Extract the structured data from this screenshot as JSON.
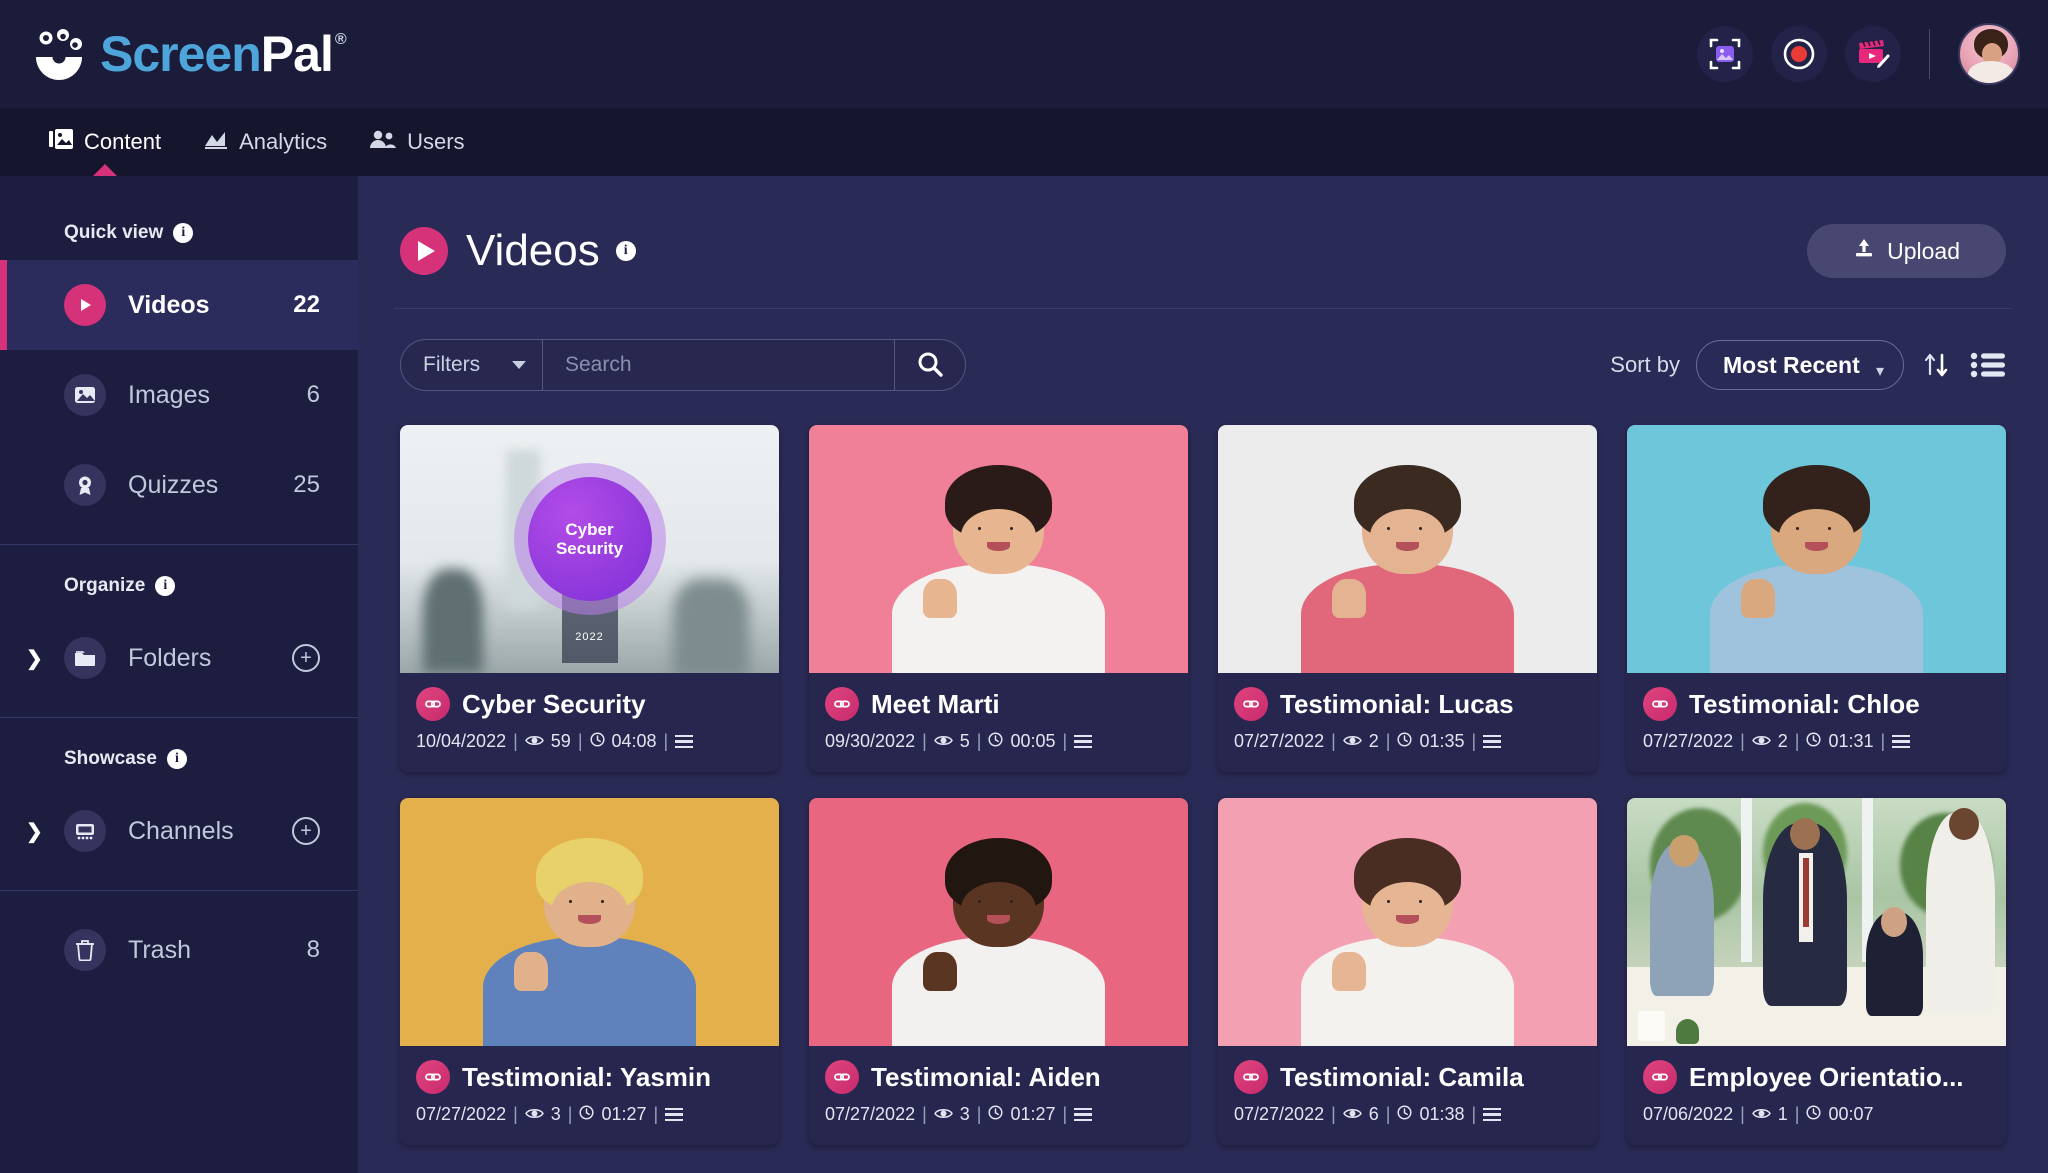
{
  "brand": {
    "name_part1": "Screen",
    "name_part2": "Pal",
    "registered": "®"
  },
  "topbar": {
    "icons": [
      {
        "name": "screenshot-capture-icon",
        "label": "Screenshot"
      },
      {
        "name": "screen-record-icon",
        "label": "Record"
      },
      {
        "name": "video-editor-icon",
        "label": "Video Editor"
      }
    ],
    "avatar_label": "Account"
  },
  "nav": {
    "items": [
      {
        "label": "Content",
        "icon": "content-icon",
        "active": true
      },
      {
        "label": "Analytics",
        "icon": "analytics-icon",
        "active": false
      },
      {
        "label": "Users",
        "icon": "users-icon",
        "active": false
      }
    ]
  },
  "sidebar": {
    "quick_view_label": "Quick view",
    "organize_label": "Organize",
    "showcase_label": "Showcase",
    "info_glyph": "i",
    "quick_view_items": [
      {
        "label": "Videos",
        "count": "22",
        "icon": "video-play-icon",
        "active": true
      },
      {
        "label": "Images",
        "count": "6",
        "icon": "image-icon",
        "active": false
      },
      {
        "label": "Quizzes",
        "count": "25",
        "icon": "quiz-badge-icon",
        "active": false
      }
    ],
    "organize_items": [
      {
        "label": "Folders",
        "icon": "folder-icon",
        "add": "+"
      }
    ],
    "showcase_items": [
      {
        "label": "Channels",
        "icon": "channel-screen-icon",
        "add": "+"
      }
    ],
    "trash": {
      "label": "Trash",
      "count": "8",
      "icon": "trash-icon"
    }
  },
  "main": {
    "title": "Videos",
    "title_icon": "video-play-icon",
    "upload_label": "Upload",
    "upload_icon": "upload-icon",
    "filters_label": "Filters",
    "search_placeholder": "Search",
    "search_value": "",
    "search_icon": "search-icon",
    "sort_label": "Sort by",
    "sort_value": "Most Recent",
    "sort_options": [
      "Most Recent"
    ],
    "sort_direction_icon": "sort-arrows-icon",
    "view_list_icon": "list-view-icon"
  },
  "colors": {
    "accent_pink": "#d6327a",
    "topbar_bg": "#1b1b3a",
    "navbar_bg": "#15152e",
    "sidebar_bg": "#1d1d40",
    "main_bg": "#2a2a56",
    "card_bg": "#26264f",
    "logo_blue": "#4da5d9"
  },
  "videos": [
    {
      "title": "Cyber Security",
      "date": "10/04/2022",
      "views": "59",
      "duration": "04:08",
      "has_menu": true,
      "thumb_type": "cyber",
      "thumb_text": "Cyber Security",
      "thumb_year": "2022"
    },
    {
      "title": "Meet Marti",
      "date": "09/30/2022",
      "views": "5",
      "duration": "00:05",
      "has_menu": true,
      "thumb_type": "portrait",
      "thumb_bg": "#f08098",
      "skin": "#e8b591",
      "hair": "#2b1b18",
      "shirt": "#f4f2f0"
    },
    {
      "title": "Testimonial: Lucas",
      "date": "07/27/2022",
      "views": "2",
      "duration": "01:35",
      "has_menu": true,
      "thumb_type": "portrait",
      "thumb_bg": "#ececed",
      "skin": "#e3b392",
      "hair": "#3a2a20",
      "shirt": "#e0687a"
    },
    {
      "title": "Testimonial: Chloe",
      "date": "07/27/2022",
      "views": "2",
      "duration": "01:31",
      "has_menu": true,
      "thumb_type": "portrait",
      "thumb_bg": "#6ec6da",
      "skin": "#d9a87f",
      "hair": "#33221c",
      "shirt": "#9fc3dd"
    },
    {
      "title": "Testimonial: Yasmin",
      "date": "07/27/2022",
      "views": "3",
      "duration": "01:27",
      "has_menu": true,
      "thumb_type": "portrait",
      "thumb_bg": "#e3b04b",
      "skin": "#e0b18b",
      "hair": "#e8d06a",
      "shirt": "#5f82bd"
    },
    {
      "title": "Testimonial: Aiden",
      "date": "07/27/2022",
      "views": "3",
      "duration": "01:27",
      "has_menu": true,
      "thumb_type": "portrait",
      "thumb_bg": "#e8667f",
      "skin": "#5a3522",
      "hair": "#221610",
      "shirt": "#f2f1ef"
    },
    {
      "title": "Testimonial: Camila",
      "date": "07/27/2022",
      "views": "6",
      "duration": "01:38",
      "has_menu": true,
      "thumb_type": "portrait",
      "thumb_bg": "#f3a0b2",
      "skin": "#e6b593",
      "hair": "#4a2d22",
      "shirt": "#f4f2ee"
    },
    {
      "title": "Employee Orientatio...",
      "date": "07/06/2022",
      "views": "1",
      "duration": "00:07",
      "has_menu": false,
      "thumb_type": "office"
    }
  ]
}
